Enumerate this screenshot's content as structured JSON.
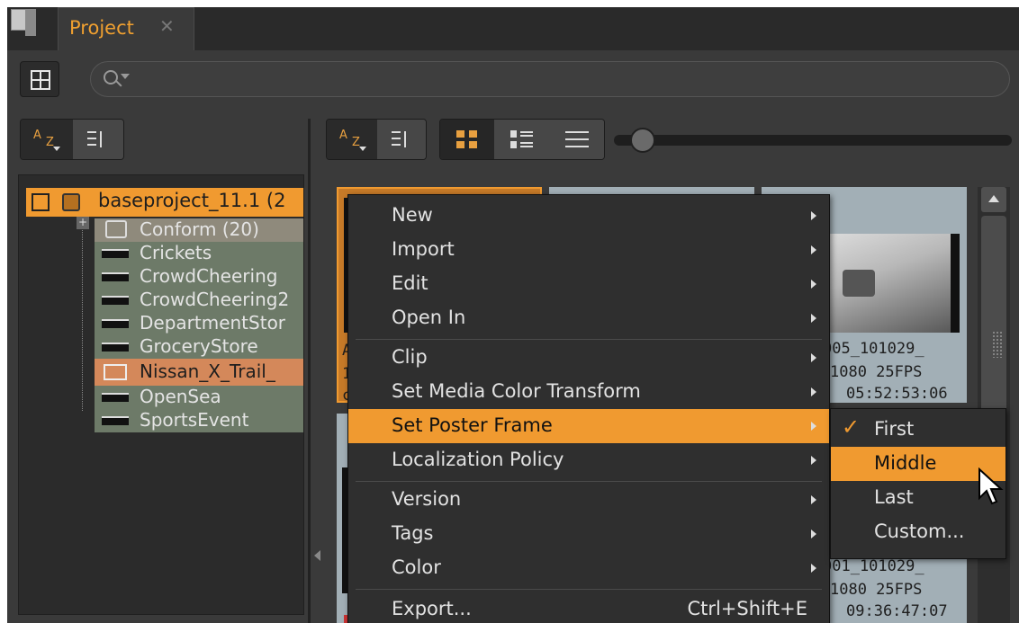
{
  "tab": {
    "title": "Project",
    "close": "✕"
  },
  "tree": {
    "root": "baseproject_11.1 (2",
    "expand": "+",
    "items": [
      "Conform (20)",
      "Crickets",
      "CrowdCheering",
      "CrowdCheering2",
      "DepartmentStor",
      "GroceryStore",
      "Nissan_X_Trail_",
      "OpenSea",
      "SportsEvent"
    ]
  },
  "sort": {
    "az_a": "A",
    "az_z": "Z"
  },
  "thumbs": {
    "t3_cap": [
      "005_101029_",
      "1080  25FPS",
      "05:52:53:06"
    ],
    "t6_cap": [
      "001_101029_",
      "1080  25FPS",
      "09:36:47:07"
    ],
    "t1_cap": [
      "A",
      "1",
      "c"
    ]
  },
  "menu": {
    "items": [
      {
        "label": "New",
        "arrow": true
      },
      {
        "label": "Import",
        "arrow": true
      },
      {
        "label": "Edit",
        "arrow": true
      },
      {
        "label": "Open In",
        "arrow": true
      },
      {
        "label": "Clip",
        "arrow": true
      },
      {
        "label": "Set Media Color Transform",
        "arrow": true
      },
      {
        "label": "Set Poster Frame",
        "arrow": true,
        "highlighted": true
      },
      {
        "label": "Localization Policy",
        "arrow": true
      },
      {
        "label": "Version",
        "arrow": true
      },
      {
        "label": "Tags",
        "arrow": true
      },
      {
        "label": "Color",
        "arrow": true
      },
      {
        "label": "Export...",
        "shortcut": "Ctrl+Shift+E"
      }
    ]
  },
  "submenu": {
    "items": [
      {
        "label": "First",
        "checked": true
      },
      {
        "label": "Middle",
        "highlighted": true
      },
      {
        "label": "Last"
      },
      {
        "label": "Custom..."
      }
    ],
    "check": "✓"
  },
  "colors": {
    "accent": "#f09a30",
    "panel": "#3a3a3a",
    "menu": "#2f2f2f",
    "tree_row": "#6d7a68"
  }
}
